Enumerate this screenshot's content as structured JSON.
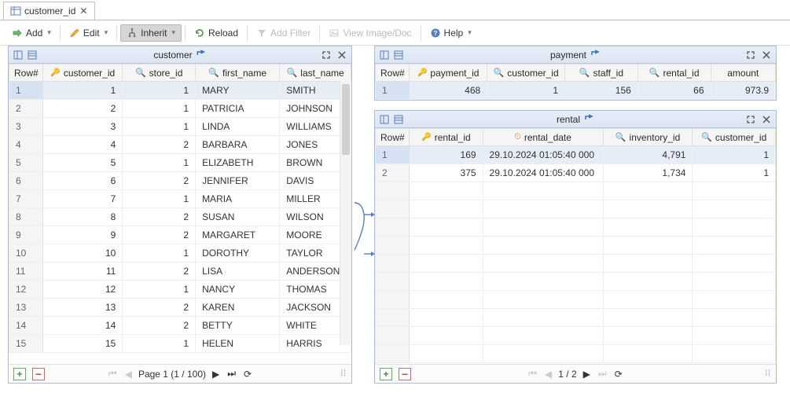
{
  "tab": {
    "label": "customer_id"
  },
  "toolbar": {
    "add": "Add",
    "edit": "Edit",
    "inherit": "Inherit",
    "reload": "Reload",
    "add_filter": "Add Filter",
    "view_image": "View Image/Doc",
    "help": "Help"
  },
  "customer_panel": {
    "title": "customer",
    "columns": [
      "Row#",
      "customer_id",
      "store_id",
      "first_name",
      "last_name"
    ],
    "rows": [
      {
        "n": "1",
        "customer_id": "1",
        "store_id": "1",
        "first_name": "MARY",
        "last_name": "SMITH"
      },
      {
        "n": "2",
        "customer_id": "2",
        "store_id": "1",
        "first_name": "PATRICIA",
        "last_name": "JOHNSON"
      },
      {
        "n": "3",
        "customer_id": "3",
        "store_id": "1",
        "first_name": "LINDA",
        "last_name": "WILLIAMS"
      },
      {
        "n": "4",
        "customer_id": "4",
        "store_id": "2",
        "first_name": "BARBARA",
        "last_name": "JONES"
      },
      {
        "n": "5",
        "customer_id": "5",
        "store_id": "1",
        "first_name": "ELIZABETH",
        "last_name": "BROWN"
      },
      {
        "n": "6",
        "customer_id": "6",
        "store_id": "2",
        "first_name": "JENNIFER",
        "last_name": "DAVIS"
      },
      {
        "n": "7",
        "customer_id": "7",
        "store_id": "1",
        "first_name": "MARIA",
        "last_name": "MILLER"
      },
      {
        "n": "8",
        "customer_id": "8",
        "store_id": "2",
        "first_name": "SUSAN",
        "last_name": "WILSON"
      },
      {
        "n": "9",
        "customer_id": "9",
        "store_id": "2",
        "first_name": "MARGARET",
        "last_name": "MOORE"
      },
      {
        "n": "10",
        "customer_id": "10",
        "store_id": "1",
        "first_name": "DOROTHY",
        "last_name": "TAYLOR"
      },
      {
        "n": "11",
        "customer_id": "11",
        "store_id": "2",
        "first_name": "LISA",
        "last_name": "ANDERSON"
      },
      {
        "n": "12",
        "customer_id": "12",
        "store_id": "1",
        "first_name": "NANCY",
        "last_name": "THOMAS"
      },
      {
        "n": "13",
        "customer_id": "13",
        "store_id": "2",
        "first_name": "KAREN",
        "last_name": "JACKSON"
      },
      {
        "n": "14",
        "customer_id": "14",
        "store_id": "2",
        "first_name": "BETTY",
        "last_name": "WHITE"
      },
      {
        "n": "15",
        "customer_id": "15",
        "store_id": "1",
        "first_name": "HELEN",
        "last_name": "HARRIS"
      }
    ],
    "footer": {
      "page_text": "Page 1 (1 / 100)"
    }
  },
  "payment_panel": {
    "title": "payment",
    "columns": [
      "Row#",
      "payment_id",
      "customer_id",
      "staff_id",
      "rental_id",
      "amount"
    ],
    "rows": [
      {
        "n": "1",
        "payment_id": "468",
        "customer_id": "1",
        "staff_id": "156",
        "rental_id": "66",
        "amount": "973.9"
      }
    ]
  },
  "rental_panel": {
    "title": "rental",
    "columns": [
      "Row#",
      "rental_id",
      "rental_date",
      "inventory_id",
      "customer_id"
    ],
    "rows": [
      {
        "n": "1",
        "rental_id": "169",
        "rental_date": "29.10.2024 01:05:40 000",
        "inventory_id": "4,791",
        "customer_id": "1"
      },
      {
        "n": "2",
        "rental_id": "375",
        "rental_date": "29.10.2024 01:05:40 000",
        "inventory_id": "1,734",
        "customer_id": "1"
      }
    ],
    "footer": {
      "page_text": "1 / 2"
    }
  }
}
